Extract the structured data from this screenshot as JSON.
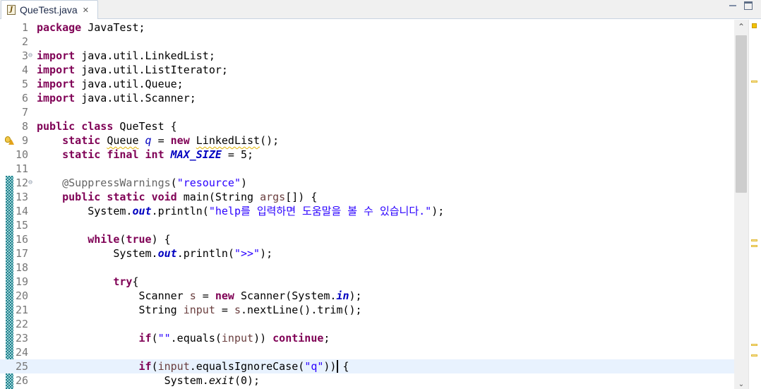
{
  "tab": {
    "title": "QueTest.java",
    "file_icon": "java-file-icon",
    "close_icon": "close-icon"
  },
  "window_controls": {
    "minimize_icon": "minimize-icon",
    "maximize_icon": "maximize-icon"
  },
  "colors": {
    "keyword": "#7f0055",
    "string": "#2a00ff",
    "static_field": "#0000c0",
    "annotation": "#646464",
    "line_number": "#787878",
    "current_line": "#e8f2fe",
    "change_bar": "#1f7d8a"
  },
  "editor": {
    "current_line": 25,
    "lines": [
      {
        "n": "1",
        "segs": [
          {
            "t": "package",
            "c": "kw"
          },
          {
            "t": " JavaTest;"
          }
        ]
      },
      {
        "n": "2",
        "segs": []
      },
      {
        "n": "3",
        "fold": "⊖",
        "segs": [
          {
            "t": "import",
            "c": "kw"
          },
          {
            "t": " java.util.LinkedList;"
          }
        ]
      },
      {
        "n": "4",
        "segs": [
          {
            "t": "import",
            "c": "kw"
          },
          {
            "t": " java.util.ListIterator;"
          }
        ]
      },
      {
        "n": "5",
        "segs": [
          {
            "t": "import",
            "c": "kw"
          },
          {
            "t": " java.util.Queue;"
          }
        ]
      },
      {
        "n": "6",
        "segs": [
          {
            "t": "import",
            "c": "kw"
          },
          {
            "t": " java.util.Scanner;"
          }
        ]
      },
      {
        "n": "7",
        "segs": []
      },
      {
        "n": "8",
        "segs": [
          {
            "t": "public",
            "c": "kw"
          },
          {
            "t": " "
          },
          {
            "t": "class",
            "c": "kw"
          },
          {
            "t": " QueTest {"
          }
        ]
      },
      {
        "n": "9",
        "warn": true,
        "segs": [
          {
            "t": "    "
          },
          {
            "t": "static",
            "c": "kw"
          },
          {
            "t": " "
          },
          {
            "t": "Queue",
            "c": "warnul"
          },
          {
            "t": " "
          },
          {
            "t": "q",
            "c": "sfield-plain"
          },
          {
            "t": " = "
          },
          {
            "t": "new",
            "c": "kw"
          },
          {
            "t": " "
          },
          {
            "t": "LinkedList",
            "c": "warnul"
          },
          {
            "t": "();"
          }
        ]
      },
      {
        "n": "10",
        "segs": [
          {
            "t": "    "
          },
          {
            "t": "static",
            "c": "kw"
          },
          {
            "t": " "
          },
          {
            "t": "final",
            "c": "kw"
          },
          {
            "t": " "
          },
          {
            "t": "int",
            "c": "kw"
          },
          {
            "t": " "
          },
          {
            "t": "MAX_SIZE",
            "c": "sfield"
          },
          {
            "t": " = 5;"
          }
        ]
      },
      {
        "n": "11",
        "segs": []
      },
      {
        "n": "12",
        "fold": "⊖",
        "segs": [
          {
            "t": "    "
          },
          {
            "t": "@SuppressWarnings",
            "c": "ann"
          },
          {
            "t": "("
          },
          {
            "t": "\"resource\"",
            "c": "str"
          },
          {
            "t": ")"
          }
        ]
      },
      {
        "n": "13",
        "segs": [
          {
            "t": "    "
          },
          {
            "t": "public",
            "c": "kw"
          },
          {
            "t": " "
          },
          {
            "t": "static",
            "c": "kw"
          },
          {
            "t": " "
          },
          {
            "t": "void",
            "c": "kw"
          },
          {
            "t": " main(String "
          },
          {
            "t": "args",
            "c": "local"
          },
          {
            "t": "[]) {"
          }
        ]
      },
      {
        "n": "14",
        "segs": [
          {
            "t": "        System."
          },
          {
            "t": "out",
            "c": "sfield"
          },
          {
            "t": ".println("
          },
          {
            "t": "\"help를 입력하면 도움말을 볼 수 있습니다.\"",
            "c": "str"
          },
          {
            "t": ");"
          }
        ]
      },
      {
        "n": "15",
        "segs": []
      },
      {
        "n": "16",
        "segs": [
          {
            "t": "        "
          },
          {
            "t": "while",
            "c": "kw"
          },
          {
            "t": "("
          },
          {
            "t": "true",
            "c": "kw"
          },
          {
            "t": ") {"
          }
        ]
      },
      {
        "n": "17",
        "segs": [
          {
            "t": "            System."
          },
          {
            "t": "out",
            "c": "sfield"
          },
          {
            "t": ".println("
          },
          {
            "t": "\">>\"",
            "c": "str"
          },
          {
            "t": ");"
          }
        ]
      },
      {
        "n": "18",
        "segs": []
      },
      {
        "n": "19",
        "segs": [
          {
            "t": "            "
          },
          {
            "t": "try",
            "c": "kw"
          },
          {
            "t": "{"
          }
        ]
      },
      {
        "n": "20",
        "segs": [
          {
            "t": "                Scanner "
          },
          {
            "t": "s",
            "c": "local"
          },
          {
            "t": " = "
          },
          {
            "t": "new",
            "c": "kw"
          },
          {
            "t": " Scanner(System."
          },
          {
            "t": "in",
            "c": "sfield"
          },
          {
            "t": ");"
          }
        ]
      },
      {
        "n": "21",
        "segs": [
          {
            "t": "                String "
          },
          {
            "t": "input",
            "c": "local"
          },
          {
            "t": " = "
          },
          {
            "t": "s",
            "c": "local"
          },
          {
            "t": ".nextLine().trim();"
          }
        ]
      },
      {
        "n": "22",
        "segs": []
      },
      {
        "n": "23",
        "segs": [
          {
            "t": "                "
          },
          {
            "t": "if",
            "c": "kw"
          },
          {
            "t": "("
          },
          {
            "t": "\"\"",
            "c": "str"
          },
          {
            "t": ".equals("
          },
          {
            "t": "input",
            "c": "local"
          },
          {
            "t": ")) "
          },
          {
            "t": "continue",
            "c": "kw"
          },
          {
            "t": ";"
          }
        ]
      },
      {
        "n": "24",
        "segs": []
      },
      {
        "n": "25",
        "segs": [
          {
            "t": "                "
          },
          {
            "t": "if",
            "c": "kw"
          },
          {
            "t": "("
          },
          {
            "t": "input",
            "c": "local"
          },
          {
            "t": ".equalsIgnoreCase("
          },
          {
            "t": "\"q\"",
            "c": "str"
          },
          {
            "t": "))"
          },
          {
            "t": "",
            "c": "caret"
          },
          {
            "t": " {"
          }
        ]
      },
      {
        "n": "26",
        "segs": [
          {
            "t": "                    System."
          },
          {
            "t": "exit",
            "c": "sitalic"
          },
          {
            "t": "(0);"
          }
        ]
      }
    ]
  }
}
